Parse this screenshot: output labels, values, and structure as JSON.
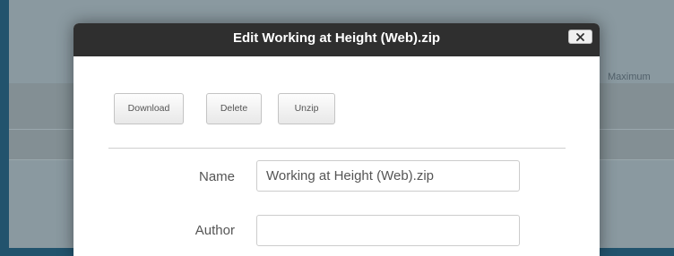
{
  "background": {
    "column_label": "Maximum"
  },
  "modal": {
    "title": "Edit Working at Height (Web).zip",
    "close_icon": "close-icon",
    "buttons": {
      "download": "Download",
      "delete": "Delete",
      "unzip": "Unzip"
    },
    "fields": {
      "name": {
        "label": "Name",
        "value": "Working at Height (Web).zip"
      },
      "author": {
        "label": "Author",
        "value": ""
      }
    }
  },
  "colors": {
    "backdrop": "#22536d",
    "header": "#2f2f2f",
    "modal_bg": "#ffffff"
  }
}
